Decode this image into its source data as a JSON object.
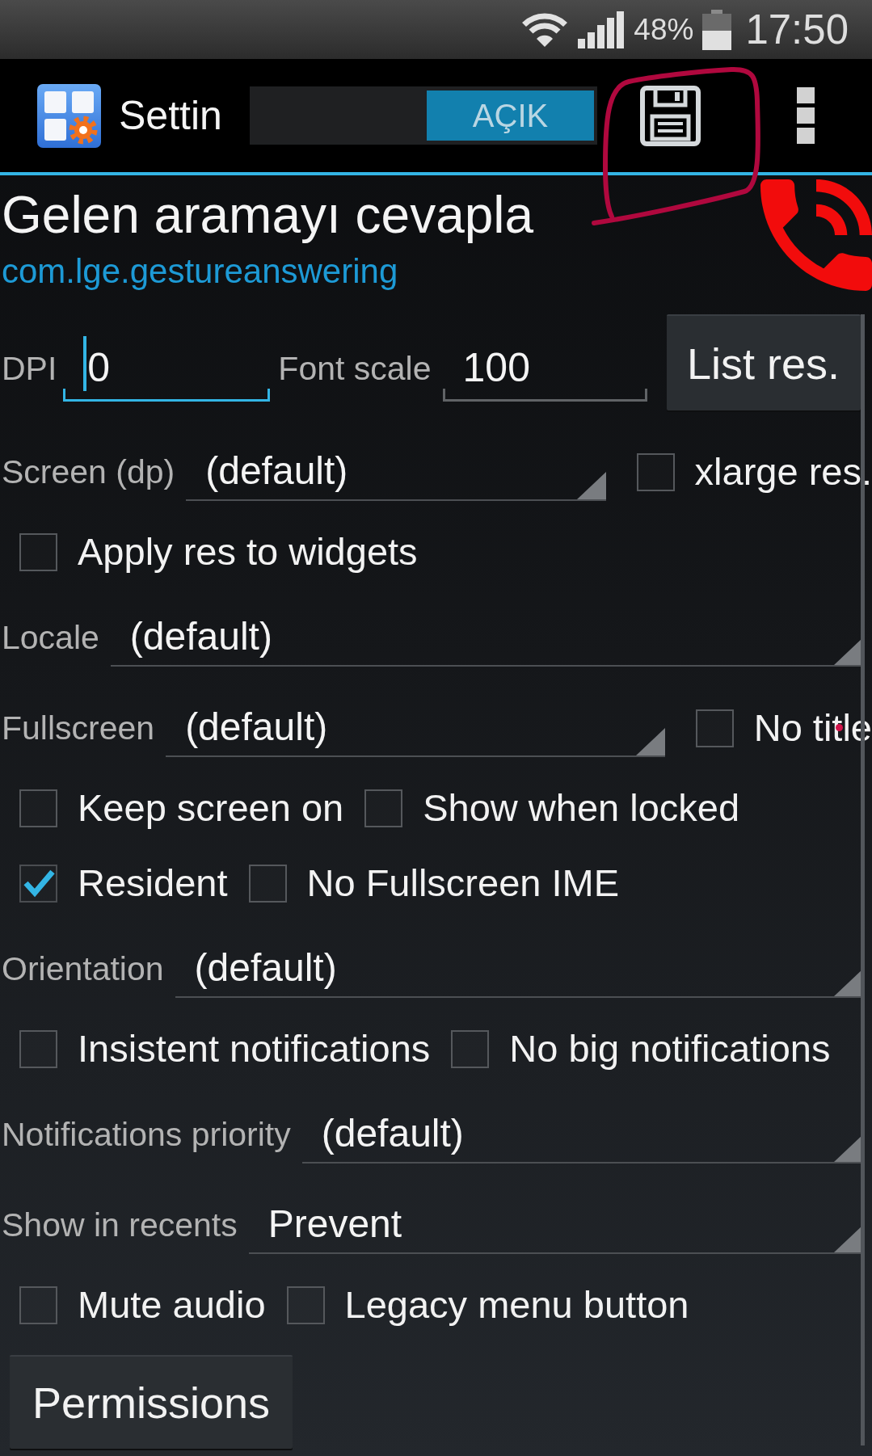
{
  "status_bar": {
    "battery": "48%",
    "time": "17:50"
  },
  "action_bar": {
    "title": "Settin",
    "toggle": {
      "label": "AÇIK",
      "on": true
    }
  },
  "app": {
    "name": "Gelen aramayı cevapla",
    "package": "com.lge.gestureanswering"
  },
  "rows": [
    {
      "kind": "inputs",
      "fields": [
        {
          "label": "DPI",
          "value": "0",
          "focused": true
        },
        {
          "label": "Font scale",
          "value": "100",
          "focused": false
        }
      ],
      "button": "List res."
    },
    {
      "kind": "spinner",
      "label": "Screen (dp)",
      "value": "(default)",
      "checkbox": {
        "label": "xlarge res.",
        "checked": false
      }
    },
    {
      "kind": "checkboxes",
      "items": [
        {
          "label": "Apply res to widgets",
          "checked": false
        }
      ]
    },
    {
      "kind": "spinner",
      "label": "Locale",
      "value": "(default)"
    },
    {
      "kind": "spinner",
      "label": "Fullscreen",
      "value": "(default)",
      "checkbox": {
        "label": "No title",
        "checked": false
      }
    },
    {
      "kind": "checkboxes",
      "items": [
        {
          "label": "Keep screen on",
          "checked": false
        },
        {
          "label": "Show when locked",
          "checked": false
        }
      ]
    },
    {
      "kind": "checkboxes",
      "items": [
        {
          "label": "Resident",
          "checked": true
        },
        {
          "label": "No Fullscreen IME",
          "checked": false
        }
      ]
    },
    {
      "kind": "spinner",
      "label": "Orientation",
      "value": "(default)"
    },
    {
      "kind": "checkboxes",
      "items": [
        {
          "label": "Insistent notifications",
          "checked": false
        },
        {
          "label": "No big notifications",
          "checked": false
        }
      ]
    },
    {
      "kind": "spinner",
      "label": "Notifications priority",
      "value": "(default)"
    },
    {
      "kind": "spinner",
      "label": "Show in recents",
      "value": "Prevent"
    },
    {
      "kind": "checkboxes",
      "items": [
        {
          "label": "Mute audio",
          "checked": false
        },
        {
          "label": "Legacy menu button",
          "checked": false
        }
      ]
    },
    {
      "kind": "button",
      "label": "Permissions"
    }
  ]
}
